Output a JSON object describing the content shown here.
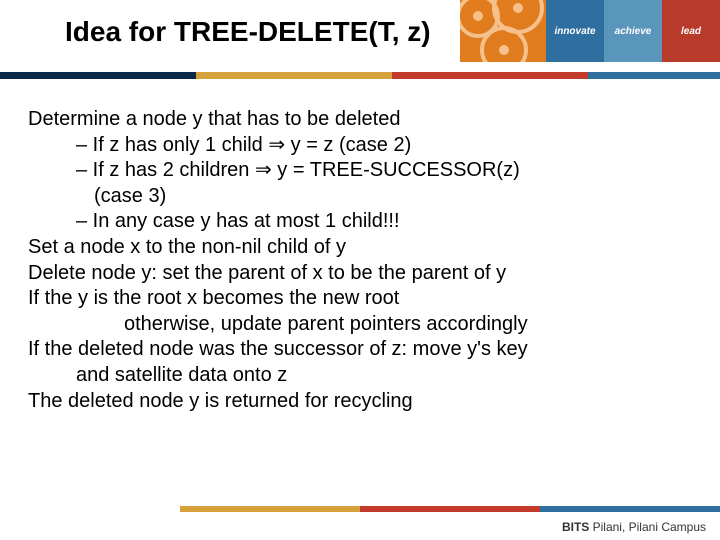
{
  "header": {
    "title": "Idea for TREE-DELETE(T, z)",
    "pills": {
      "innovate": "innovate",
      "achieve": "achieve",
      "lead": "lead"
    }
  },
  "body": {
    "l1": "Determine a node y that has to be deleted",
    "l2": "– If z has only 1 child ⇒ y = z (case 2)",
    "l3": "– If z has 2 children ⇒ y = TREE-SUCCESSOR(z)",
    "l3b": "(case 3)",
    "l4": "– In any case y has at most 1 child!!!",
    "l5": "Set a node x to the non-nil child of y",
    "l6": "Delete node y: set the parent of x to be the parent of y",
    "l7": "If the y is the root x becomes the new root",
    "l7b": "otherwise, update parent pointers accordingly",
    "l8": "If the deleted node was the successor of z: move y's key",
    "l8b": "and satellite data onto z",
    "l9": "The deleted node y is returned for recycling"
  },
  "footer": {
    "brand": "BITS",
    "campus": " Pilani, Pilani Campus"
  }
}
